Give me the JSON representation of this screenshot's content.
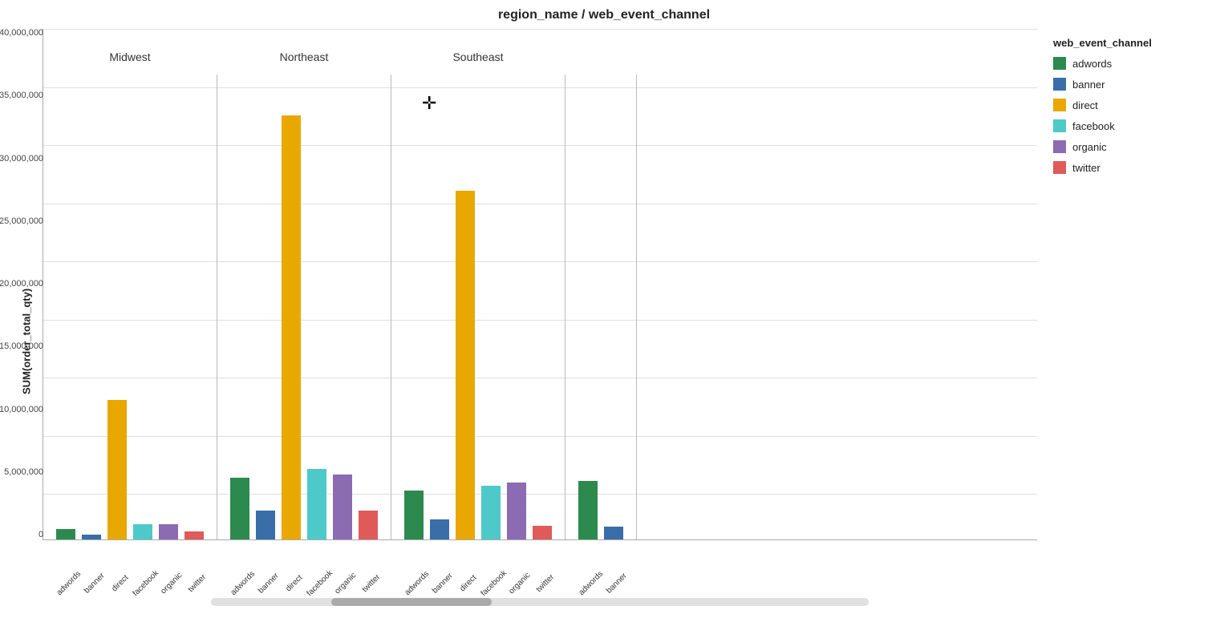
{
  "title": "region_name / web_event_channel",
  "yAxisLabel": "SUM(order_total_qty)",
  "yTicks": [
    "40000000",
    "35000000",
    "30000000",
    "25000000",
    "20000000",
    "15000000",
    "10000000",
    "5000000",
    "0"
  ],
  "colors": {
    "adwords": "#2d8a4e",
    "banner": "#3a6ea8",
    "direct": "#e8a800",
    "facebook": "#4ec9c9",
    "organic": "#8b6bb1",
    "twitter": "#e05a5a"
  },
  "legend": {
    "title": "web_event_channel",
    "items": [
      {
        "label": "adwords",
        "color": "#2d8a4e"
      },
      {
        "label": "banner",
        "color": "#3a6ea8"
      },
      {
        "label": "direct",
        "color": "#e8a800"
      },
      {
        "label": "facebook",
        "color": "#4ec9c9"
      },
      {
        "label": "organic",
        "color": "#8b6bb1"
      },
      {
        "label": "twitter",
        "color": "#e05a5a"
      }
    ]
  },
  "regions": [
    {
      "name": "Midwest",
      "bars": [
        {
          "channel": "adwords",
          "value": 900000
        },
        {
          "channel": "banner",
          "value": 400000
        },
        {
          "channel": "direct",
          "value": 12000000
        },
        {
          "channel": "facebook",
          "value": 1300000
        },
        {
          "channel": "organic",
          "value": 1300000
        },
        {
          "channel": "twitter",
          "value": 700000
        }
      ]
    },
    {
      "name": "Northeast",
      "bars": [
        {
          "channel": "adwords",
          "value": 5300000
        },
        {
          "channel": "banner",
          "value": 2500000
        },
        {
          "channel": "direct",
          "value": 36500000
        },
        {
          "channel": "facebook",
          "value": 6100000
        },
        {
          "channel": "organic",
          "value": 5600000
        },
        {
          "channel": "twitter",
          "value": 2500000
        }
      ]
    },
    {
      "name": "Southeast",
      "bars": [
        {
          "channel": "adwords",
          "value": 4200000
        },
        {
          "channel": "banner",
          "value": 1700000
        },
        {
          "channel": "direct",
          "value": 30000000
        },
        {
          "channel": "facebook",
          "value": 4600000
        },
        {
          "channel": "organic",
          "value": 4900000
        },
        {
          "channel": "twitter",
          "value": 1200000
        }
      ]
    },
    {
      "name": "",
      "bars": [
        {
          "channel": "adwords",
          "value": 5000000
        },
        {
          "channel": "banner",
          "value": 1100000
        }
      ]
    }
  ],
  "scrollbar": {
    "trackWidth": 820,
    "thumbWidth": 200,
    "thumbLeft": 150
  }
}
